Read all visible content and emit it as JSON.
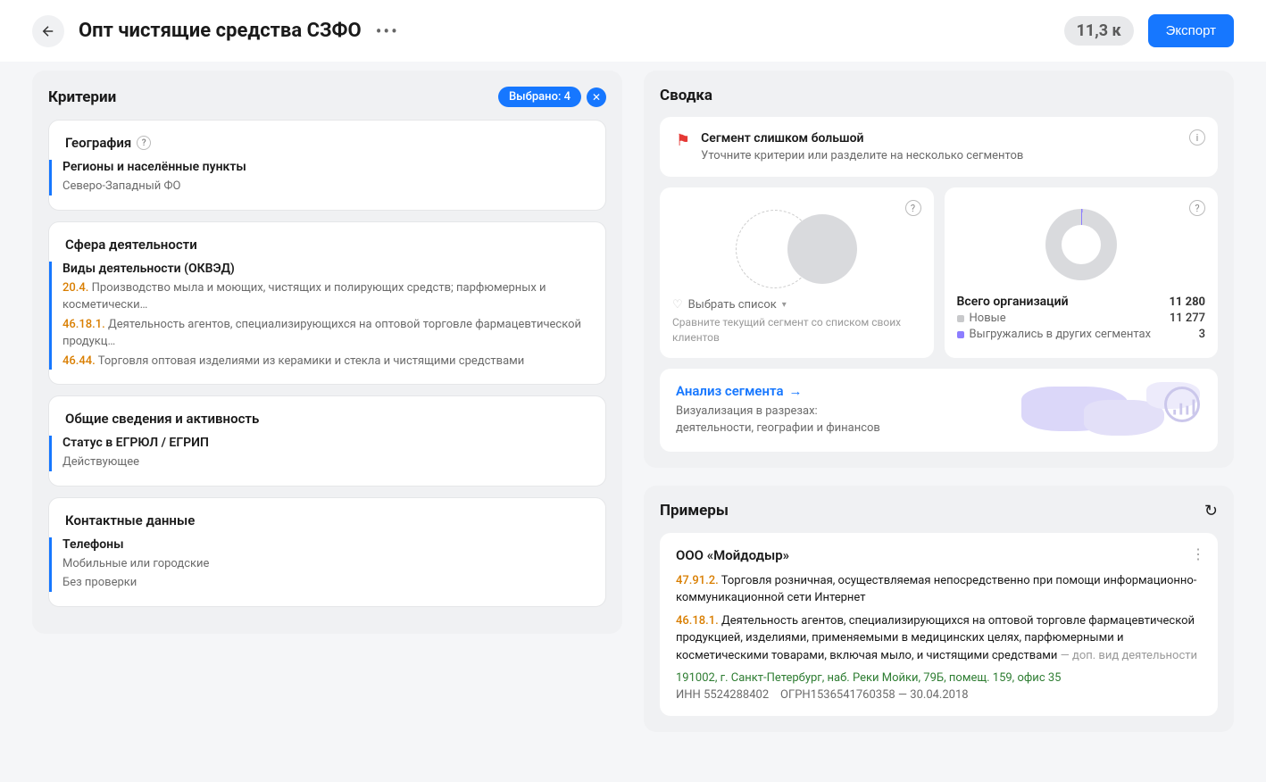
{
  "header": {
    "title": "Опт чистящие средства СЗФО",
    "count": "11,3 к",
    "export_label": "Экспорт"
  },
  "criteria": {
    "title": "Критерии",
    "selected_label": "Выбрано: 4",
    "geography": {
      "title": "География",
      "block_label": "Регионы и населённые пункты",
      "block_value": "Северо-Западный ФО"
    },
    "activity": {
      "title": "Сфера деятельности",
      "block_label": "Виды деятельности (ОКВЭД)",
      "items": [
        {
          "code": "20.4.",
          "text": "Производство мыла и моющих, чистящих и полирующих средств; парфюмерных и косметически…"
        },
        {
          "code": "46.18.1.",
          "text": "Деятельность агентов, специализирующихся на оптовой торговле фармацевтической продукц…"
        },
        {
          "code": "46.44.",
          "text": "Торговля оптовая изделиями из керамики и стекла и чистящими средствами"
        }
      ]
    },
    "general": {
      "title": "Общие сведения и активность",
      "block_label": "Статус в ЕГРЮЛ / ЕГРИП",
      "block_value": "Действующее"
    },
    "contacts": {
      "title": "Контактные данные",
      "block_label": "Телефоны",
      "values": [
        "Мобильные или городские",
        "Без проверки"
      ]
    }
  },
  "summary": {
    "title": "Сводка",
    "warning_title": "Сегмент слишком большой",
    "warning_sub": "Уточните критерии или разделите на несколько сегментов",
    "select_list_label": "Выбрать список",
    "select_list_hint": "Сравните текущий сегмент со списком своих клиентов",
    "stats": {
      "total_label": "Всего организаций",
      "total_value": "11 280",
      "new_label": "Новые",
      "new_value": "11 277",
      "exported_label": "Выгружались в других сегментах",
      "exported_value": "3"
    },
    "analysis": {
      "link": "Анализ сегмента",
      "sub1": "Визуализация в разрезах:",
      "sub2": "деятельности, географии и финансов"
    }
  },
  "examples": {
    "title": "Примеры",
    "company": {
      "name": "ООО «Мойдодыр»",
      "activities": [
        {
          "code": "47.91.2.",
          "text": "Торговля розничная, осуществляемая непосредственно при помощи информационно-коммуникационной сети Интернет",
          "note": ""
        },
        {
          "code": "46.18.1.",
          "text": "Деятельность агентов, специализирующихся на оптовой торговле фармацевтической продукцией, изделиями, применяемыми в медицинских целях, парфюмерными и косметическими товарами, включая мыло, и чистящими средствами",
          "note": " — доп. вид деятельности"
        }
      ],
      "address": "191002, г. Санкт-Петербург, наб. Реки Мойки, 79Б, помещ. 159, офис 35",
      "inn_label": "ИНН",
      "inn": "5524288402",
      "ogrn_label": "ОГРН",
      "ogrn": "1536541760358",
      "date": "30.04.2018"
    }
  },
  "chart_data": {
    "type": "pie",
    "title": "Всего организаций",
    "total": 11280,
    "series": [
      {
        "name": "Новые",
        "value": 11277
      },
      {
        "name": "Выгружались в других сегментах",
        "value": 3
      }
    ]
  }
}
